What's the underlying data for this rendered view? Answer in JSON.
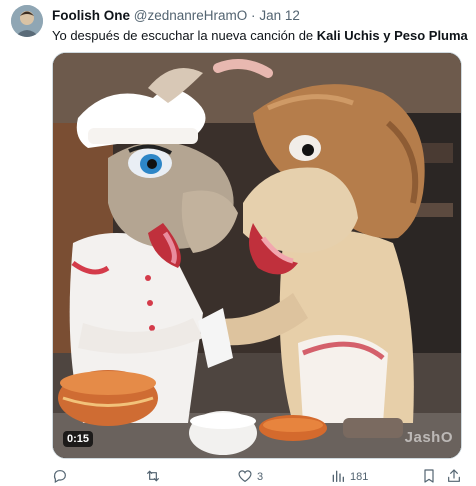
{
  "tweet": {
    "display_name": "Foolish One",
    "handle": "@zednanreHramO",
    "separator": "·",
    "date": "Jan 12",
    "text_prefix": "Yo después de escuchar la nueva canción de ",
    "text_bold": "Kali Uchis y Peso Pluma"
  },
  "media": {
    "duration": "0:15",
    "watermark": "JashO"
  },
  "actions": {
    "replies": "",
    "retweets": "",
    "likes": "3",
    "views": "181",
    "icons": [
      "reply-icon",
      "retweet-icon",
      "like-icon",
      "views-icon",
      "bookmark-icon",
      "share-icon"
    ]
  },
  "colors": {
    "text_primary": "#0f1419",
    "text_secondary": "#536471",
    "border": "#cfd9de"
  }
}
